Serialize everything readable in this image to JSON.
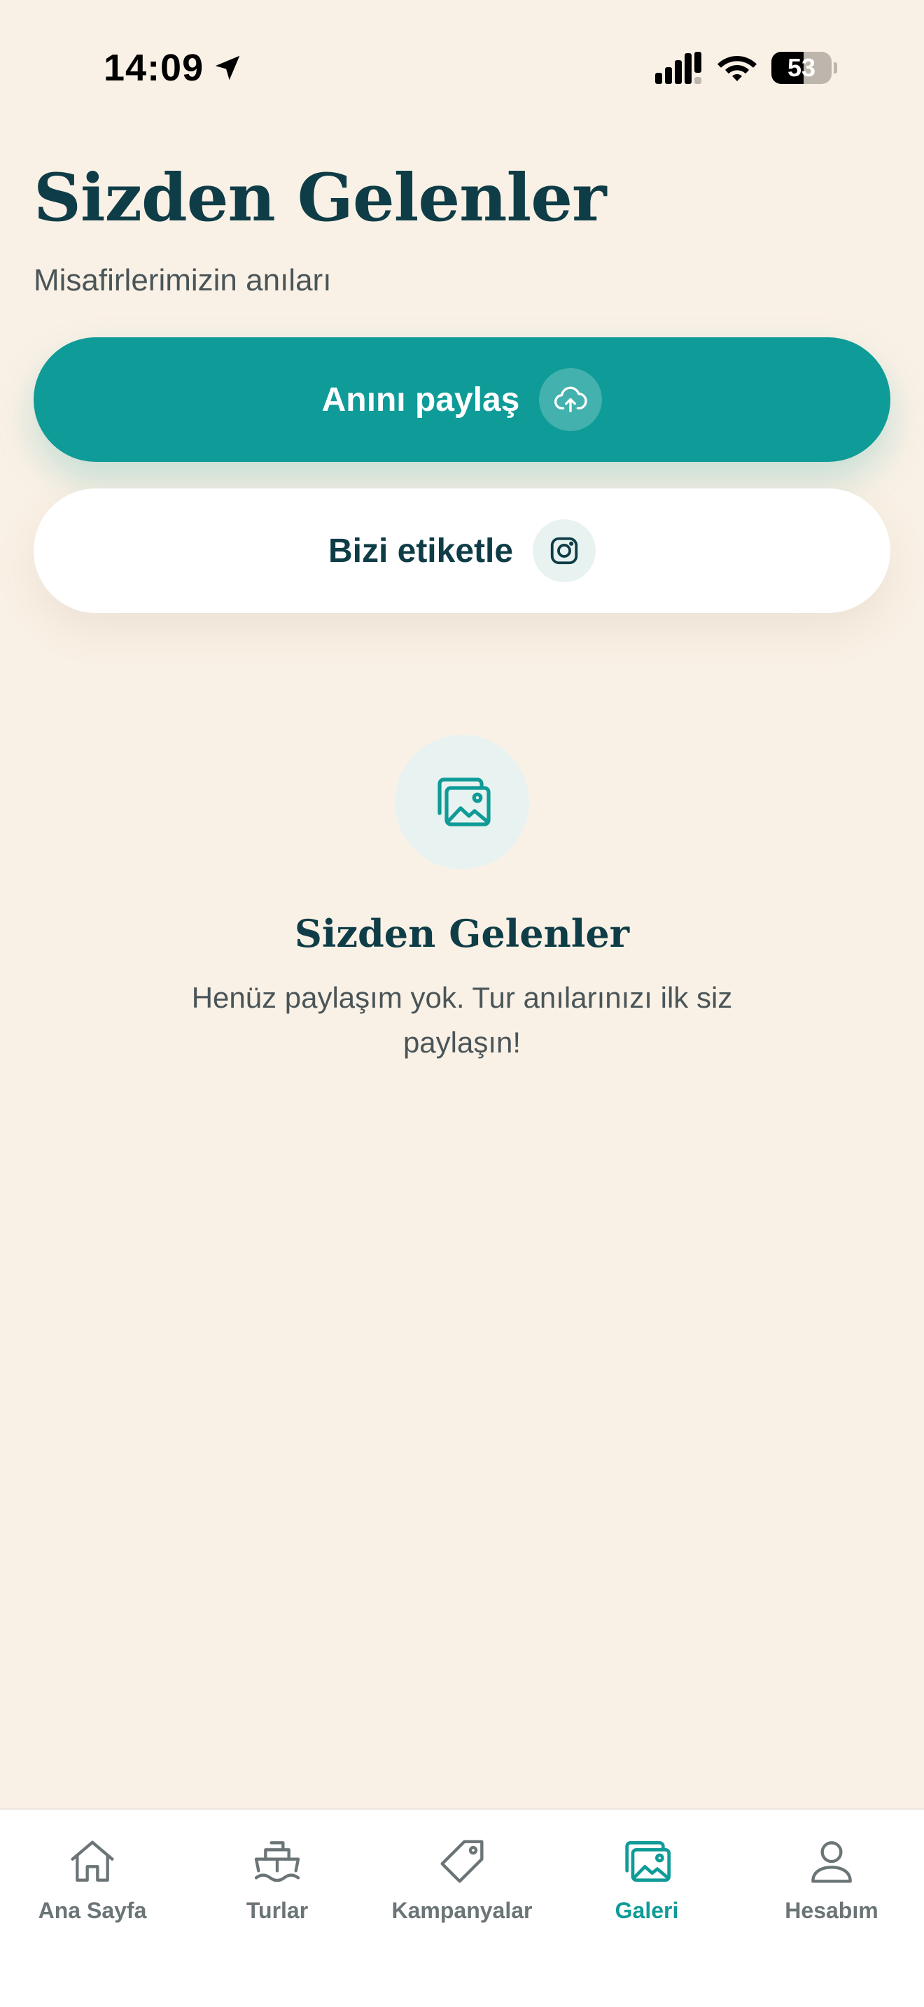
{
  "status_bar": {
    "time": "14:09",
    "battery_level": "53"
  },
  "header": {
    "title": "Sizden Gelenler",
    "subtitle": "Misafirlerimizin anıları"
  },
  "actions": {
    "share_label": "Anını paylaş",
    "tag_label": "Bizi etiketle"
  },
  "empty_state": {
    "title": "Sizden Gelenler",
    "message": "Henüz paylaşım yok. Tur anılarınızı ilk siz paylaşın!"
  },
  "tab_bar": {
    "tabs": [
      {
        "label": "Ana Sayfa",
        "icon": "home-icon"
      },
      {
        "label": "Turlar",
        "icon": "boat-icon"
      },
      {
        "label": "Kampanyalar",
        "icon": "tag-icon"
      },
      {
        "label": "Galeri",
        "icon": "gallery-icon",
        "active": true
      },
      {
        "label": "Hesabım",
        "icon": "user-icon"
      }
    ]
  },
  "colors": {
    "background": "#FAF1E6",
    "accent": "#0F9B97",
    "primary_text": "#0F3D47",
    "secondary_text": "#4A5558"
  }
}
